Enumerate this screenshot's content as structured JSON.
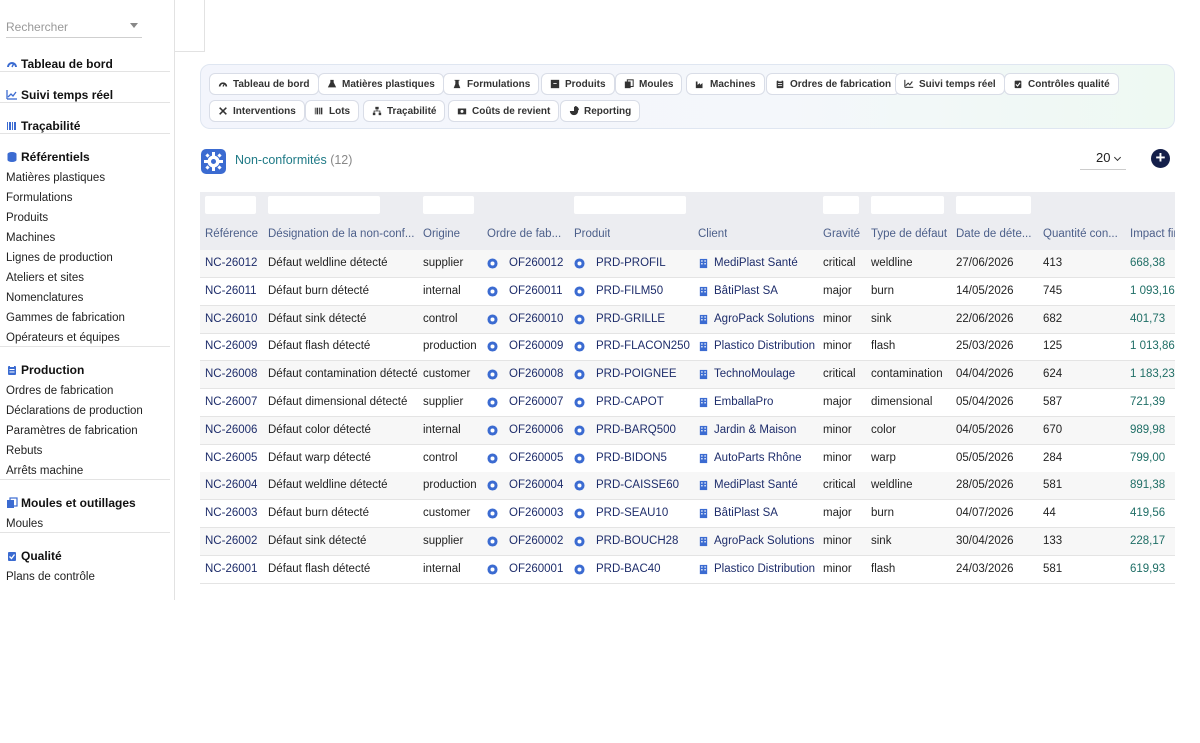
{
  "search": {
    "placeholder": "Rechercher"
  },
  "sidebar": {
    "sections": [
      {
        "title": "Tableau de bord",
        "icon": "gauge-icon",
        "items": []
      },
      {
        "title": "Suivi temps réel",
        "icon": "chart-line-icon",
        "items": []
      },
      {
        "title": "Traçabilité",
        "icon": "barcode-icon",
        "items": []
      },
      {
        "title": "Référentiels",
        "icon": "database-icon",
        "items": [
          "Matières plastiques",
          "Formulations",
          "Produits",
          "Machines",
          "Lignes de production",
          "Ateliers et sites",
          "Nomenclatures",
          "Gammes de fabrication",
          "Opérateurs et équipes"
        ]
      },
      {
        "title": "Production",
        "icon": "clipboard-icon",
        "items": [
          "Ordres de fabrication",
          "Déclarations de production",
          "Paramètres de fabrication",
          "Rebuts",
          "Arrêts machine"
        ]
      },
      {
        "title": "Moules et outillages",
        "icon": "copy-icon",
        "items": [
          "Moules"
        ]
      },
      {
        "title": "Qualité",
        "icon": "clipboard-check-icon",
        "items": [
          "Plans de contrôle"
        ]
      }
    ]
  },
  "modules": [
    {
      "label": "Tableau de bord",
      "icon": "gauge-icon"
    },
    {
      "label": "Matières plastiques",
      "icon": "flask-icon"
    },
    {
      "label": "Formulations",
      "icon": "beaker-icon"
    },
    {
      "label": "Produits",
      "icon": "box-icon"
    },
    {
      "label": "Moules",
      "icon": "copy-icon"
    },
    {
      "label": "Machines",
      "icon": "industry-icon"
    },
    {
      "label": "Ordres de fabrication",
      "icon": "clipboard-icon"
    },
    {
      "label": "Suivi temps réel",
      "icon": "chart-line-icon"
    },
    {
      "label": "Contrôles qualité",
      "icon": "clipboard-check-icon"
    },
    {
      "label": "Interventions",
      "icon": "tools-icon"
    },
    {
      "label": "Lots",
      "icon": "barcode-icon"
    },
    {
      "label": "Traçabilité",
      "icon": "sitemap-icon"
    },
    {
      "label": "Coûts de revient",
      "icon": "money-icon"
    },
    {
      "label": "Reporting",
      "icon": "pie-chart-icon"
    }
  ],
  "page": {
    "title": "Non-conformités",
    "count": "(12)",
    "page_size": "20",
    "add_label": "+"
  },
  "table": {
    "columns": [
      "Référence",
      "Désignation de la non-conf...",
      "Origine",
      "Ordre de fab...",
      "Produit",
      "Client",
      "Gravité",
      "Type de défaut",
      "Date de déte...",
      "Quantité con...",
      "Impact fir"
    ],
    "rows": [
      [
        "NC-26012",
        "Défaut weldline détecté",
        "supplier",
        "OF260012",
        "PRD-PROFIL",
        "MediPlast Santé",
        "critical",
        "weldline",
        "27/06/2026",
        "413",
        "668,38"
      ],
      [
        "NC-26011",
        "Défaut burn détecté",
        "internal",
        "OF260011",
        "PRD-FILM50",
        "BâtiPlast SA",
        "major",
        "burn",
        "14/05/2026",
        "745",
        "1 093,16"
      ],
      [
        "NC-26010",
        "Défaut sink détecté",
        "control",
        "OF260010",
        "PRD-GRILLE",
        "AgroPack Solutions",
        "minor",
        "sink",
        "22/06/2026",
        "682",
        "401,73"
      ],
      [
        "NC-26009",
        "Défaut flash détecté",
        "production",
        "OF260009",
        "PRD-FLACON250",
        "Plastico Distribution",
        "minor",
        "flash",
        "25/03/2026",
        "125",
        "1 013,86"
      ],
      [
        "NC-26008",
        "Défaut contamination détecté",
        "customer",
        "OF260008",
        "PRD-POIGNEE",
        "TechnoMoulage",
        "critical",
        "contamination",
        "04/04/2026",
        "624",
        "1 183,23"
      ],
      [
        "NC-26007",
        "Défaut dimensional détecté",
        "supplier",
        "OF260007",
        "PRD-CAPOT",
        "EmballaPro",
        "major",
        "dimensional",
        "05/04/2026",
        "587",
        "721,39"
      ],
      [
        "NC-26006",
        "Défaut color détecté",
        "internal",
        "OF260006",
        "PRD-BARQ500",
        "Jardin & Maison",
        "minor",
        "color",
        "04/05/2026",
        "670",
        "989,98"
      ],
      [
        "NC-26005",
        "Défaut warp détecté",
        "control",
        "OF260005",
        "PRD-BIDON5",
        "AutoParts Rhône",
        "minor",
        "warp",
        "05/05/2026",
        "284",
        "799,00"
      ],
      [
        "NC-26004",
        "Défaut weldline détecté",
        "production",
        "OF260004",
        "PRD-CAISSE60",
        "MediPlast Santé",
        "critical",
        "weldline",
        "28/05/2026",
        "581",
        "891,38"
      ],
      [
        "NC-26003",
        "Défaut burn détecté",
        "customer",
        "OF260003",
        "PRD-SEAU10",
        "BâtiPlast SA",
        "major",
        "burn",
        "04/07/2026",
        "44",
        "419,56"
      ],
      [
        "NC-26002",
        "Défaut sink détecté",
        "supplier",
        "OF260002",
        "PRD-BOUCH28",
        "AgroPack Solutions",
        "minor",
        "sink",
        "30/04/2026",
        "133",
        "228,17"
      ],
      [
        "NC-26001",
        "Défaut flash détecté",
        "internal",
        "OF260001",
        "PRD-BAC40",
        "Plastico Distribution",
        "minor",
        "flash",
        "24/03/2026",
        "581",
        "619,93"
      ]
    ]
  },
  "colors": {
    "accent": "#3b6bd1",
    "link": "#1e2d6b",
    "title": "#1f7a86",
    "money": "#1f6e66",
    "add": "#141f4a"
  }
}
